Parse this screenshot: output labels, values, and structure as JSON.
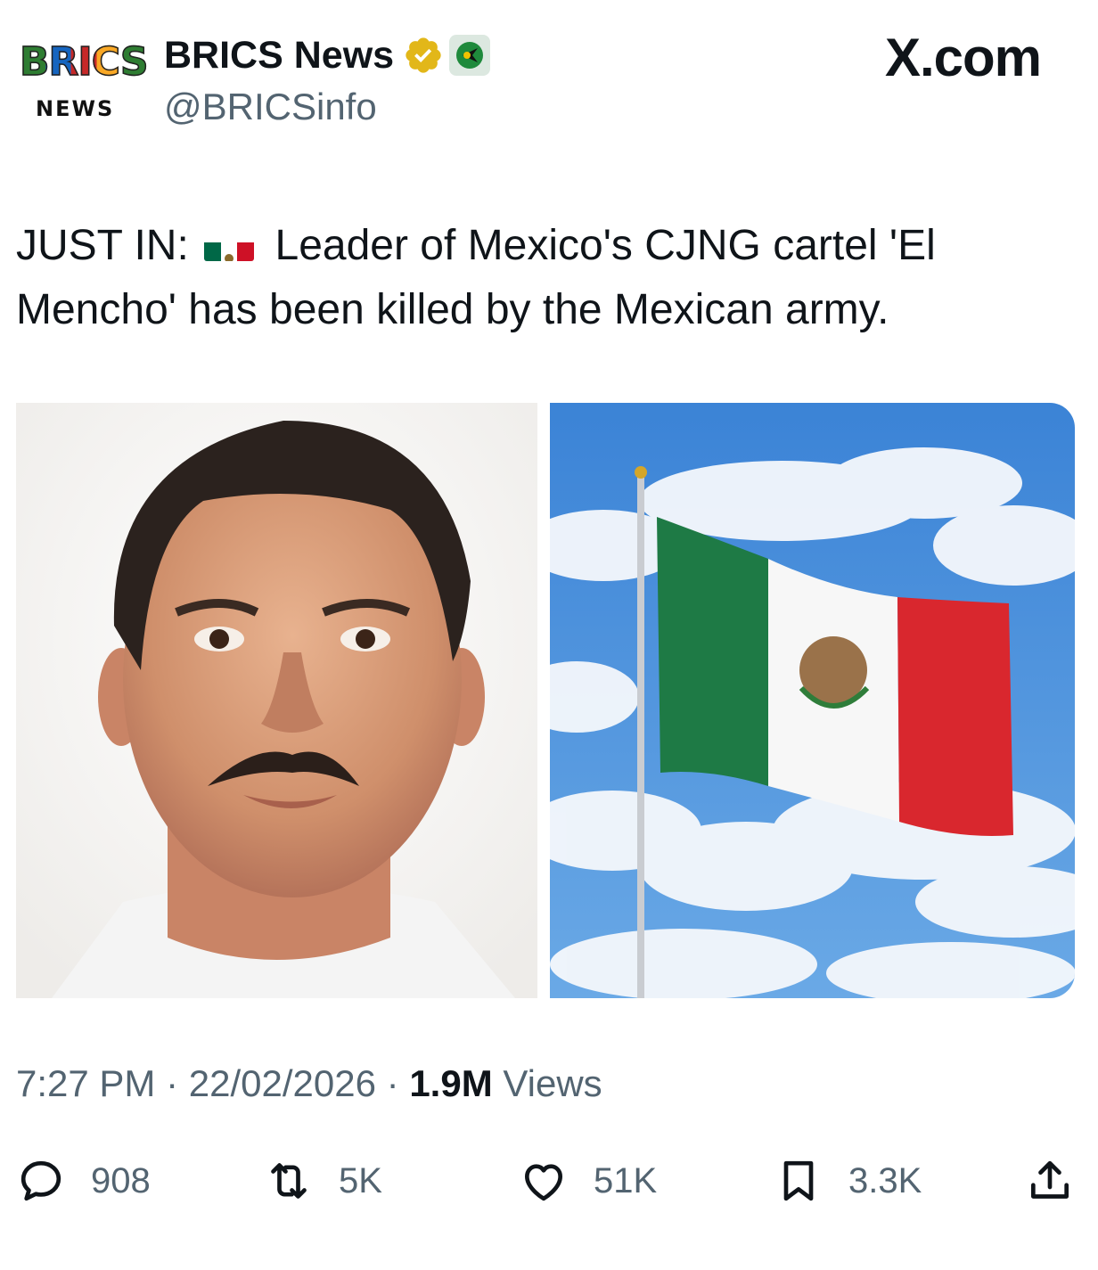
{
  "header": {
    "avatar_word": "BRICS",
    "avatar_subword": "NEWS",
    "display_name": "BRICS News",
    "handle": "@BRICSinfo",
    "site_label": "X.com"
  },
  "tweet": {
    "prefix": "JUST IN:",
    "body": "Leader of Mexico's CJNG cartel 'El Mencho' has been killed by the Mexican army."
  },
  "meta": {
    "time": "7:27 PM",
    "separator": "·",
    "date": "22/02/2026",
    "views_count": "1.9M",
    "views_label": "Views"
  },
  "actions": {
    "replies": "908",
    "reposts": "5K",
    "likes": "51K",
    "bookmarks": "3.3K"
  },
  "colors": {
    "text_primary": "#0f1419",
    "text_secondary": "#536471",
    "verified_gold": "#e2b719",
    "flag_green": "#006847",
    "flag_red": "#ce1126"
  },
  "icons": [
    "verified-icon",
    "affiliate-badge-icon",
    "reply-icon",
    "repost-icon",
    "like-icon",
    "bookmark-icon",
    "share-icon"
  ]
}
